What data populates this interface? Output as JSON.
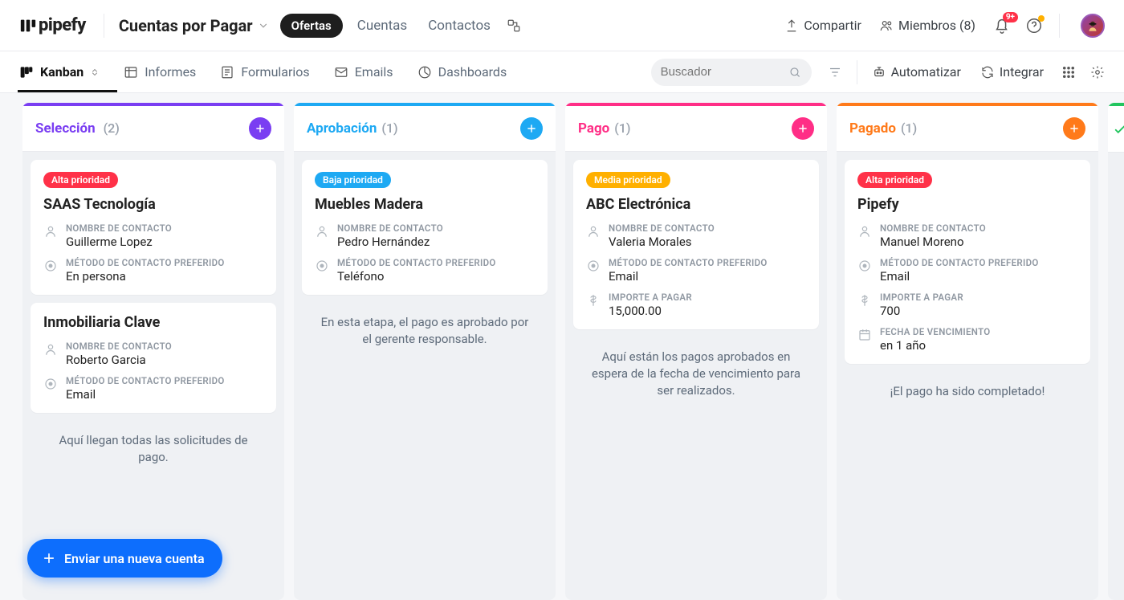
{
  "brand": "pipefy",
  "pipe_name": "Cuentas por Pagar",
  "header_chip": "Ofertas",
  "header_links": {
    "cuentas": "Cuentas",
    "contactos": "Contactos"
  },
  "actions": {
    "share": "Compartir",
    "members": "Miembros (8)"
  },
  "notifications": {
    "badge": "9+"
  },
  "secondbar": {
    "kanban": "Kanban",
    "informes": "Informes",
    "formularios": "Formularios",
    "emails": "Emails",
    "dashboards": "Dashboards",
    "search_placeholder": "Buscador",
    "automatizar": "Automatizar",
    "integrar": "Integrar"
  },
  "labels": {
    "contact_name": "NOMBRE DE CONTACTO",
    "preferred_contact": "MÉTODO DE CONTACTO PREFERIDO",
    "amount": "IMPORTE A PAGAR",
    "due_date": "FECHA DE VENCIMIENTO"
  },
  "columns": {
    "seleccion": {
      "title": "Selección",
      "count": "(2)",
      "hint": "Aquí llegan todas las solicitudes de pago.",
      "cards": {
        "saas": {
          "priority": "Alta prioridad",
          "title": "SAAS Tecnología",
          "contact": "Guillerme Lopez",
          "method": "En persona"
        },
        "inmo": {
          "title": "Inmobiliaria Clave",
          "contact": "Roberto Garcia",
          "method": "Email"
        }
      }
    },
    "aprobacion": {
      "title": "Aprobación",
      "count": "(1)",
      "hint": "En esta etapa, el pago es aprobado por el gerente responsable.",
      "cards": {
        "muebles": {
          "priority": "Baja prioridad",
          "title": "Muebles Madera",
          "contact": "Pedro Hernández",
          "method": "Teléfono"
        }
      }
    },
    "pago": {
      "title": "Pago",
      "count": "(1)",
      "hint": "Aquí están los pagos aprobados en espera de la fecha de vencimiento para ser realizados.",
      "cards": {
        "abc": {
          "priority": "Media prioridad",
          "title": "ABC Electrónica",
          "contact": "Valeria Morales",
          "method": "Email",
          "amount": "15,000.00"
        }
      }
    },
    "pagado": {
      "title": "Pagado",
      "count": "(1)",
      "hint": "¡El pago ha sido completado!",
      "cards": {
        "pipefy": {
          "priority": "Alta prioridad",
          "title": "Pipefy",
          "contact": "Manuel Moreno",
          "method": "Email",
          "amount": "700",
          "due": "en 1 año"
        }
      }
    }
  },
  "fab": "Enviar una nueva cuenta"
}
